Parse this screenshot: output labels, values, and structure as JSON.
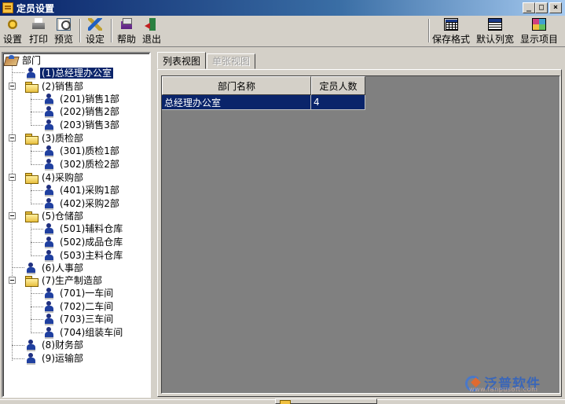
{
  "window": {
    "title": "定员设置",
    "controls": [
      "_",
      "□",
      "×"
    ]
  },
  "toolbar": {
    "left_buttons": [
      {
        "label": "设置",
        "icon": "settings-icon"
      },
      {
        "label": "打印",
        "icon": "printer-icon"
      },
      {
        "label": "预览",
        "icon": "preview-icon"
      },
      {
        "label": "设定",
        "icon": "configure-icon"
      },
      {
        "label": "帮助",
        "icon": "help-book-icon"
      },
      {
        "label": "退出",
        "icon": "exit-door-icon"
      }
    ],
    "right_buttons": [
      {
        "label": "保存格式",
        "icon": "save-format-grid-icon"
      },
      {
        "label": "默认列宽",
        "icon": "default-column-width-icon"
      },
      {
        "label": "显示项目",
        "icon": "display-items-icon"
      }
    ]
  },
  "tree": {
    "root": "部门",
    "nodes": [
      {
        "label": "(1)总经理办公室",
        "type": "person",
        "selected": true
      },
      {
        "label": "(2)销售部",
        "type": "folder",
        "expanded": true
      },
      {
        "label": "(201)销售1部",
        "type": "person"
      },
      {
        "label": "(202)销售2部",
        "type": "person"
      },
      {
        "label": "(203)销售3部",
        "type": "person"
      },
      {
        "label": "(3)质检部",
        "type": "folder",
        "expanded": true
      },
      {
        "label": "(301)质检1部",
        "type": "person"
      },
      {
        "label": "(302)质检2部",
        "type": "person"
      },
      {
        "label": "(4)采购部",
        "type": "folder",
        "expanded": true
      },
      {
        "label": "(401)采购1部",
        "type": "person"
      },
      {
        "label": "(402)采购2部",
        "type": "person"
      },
      {
        "label": "(5)仓储部",
        "type": "folder",
        "expanded": true
      },
      {
        "label": "(501)辅料仓库",
        "type": "person"
      },
      {
        "label": "(502)成品仓库",
        "type": "person"
      },
      {
        "label": "(503)主料仓库",
        "type": "person"
      },
      {
        "label": "(6)人事部",
        "type": "person"
      },
      {
        "label": "(7)生产制造部",
        "type": "folder",
        "expanded": true
      },
      {
        "label": "(701)一车间",
        "type": "person"
      },
      {
        "label": "(702)二车间",
        "type": "person"
      },
      {
        "label": "(703)三车间",
        "type": "person"
      },
      {
        "label": "(704)组装车间",
        "type": "person"
      },
      {
        "label": "(8)财务部",
        "type": "person"
      },
      {
        "label": "(9)运输部",
        "type": "person"
      }
    ]
  },
  "tabs": [
    {
      "label": "列表视图",
      "active": true
    },
    {
      "label": "单张视图",
      "active": false
    }
  ],
  "grid": {
    "columns": [
      "部门名称",
      "定员人数"
    ],
    "rows": [
      [
        "总经理办公室",
        "4"
      ]
    ]
  },
  "watermark": {
    "brand": "泛普软件",
    "url": "www.fanpusoft.com"
  },
  "colors": {
    "selection": "#0a246a",
    "title_gradient_start": "#0a246a",
    "grid_background": "#808080",
    "brand_blue": "#3a66b8",
    "brand_orange": "#e06a30"
  }
}
